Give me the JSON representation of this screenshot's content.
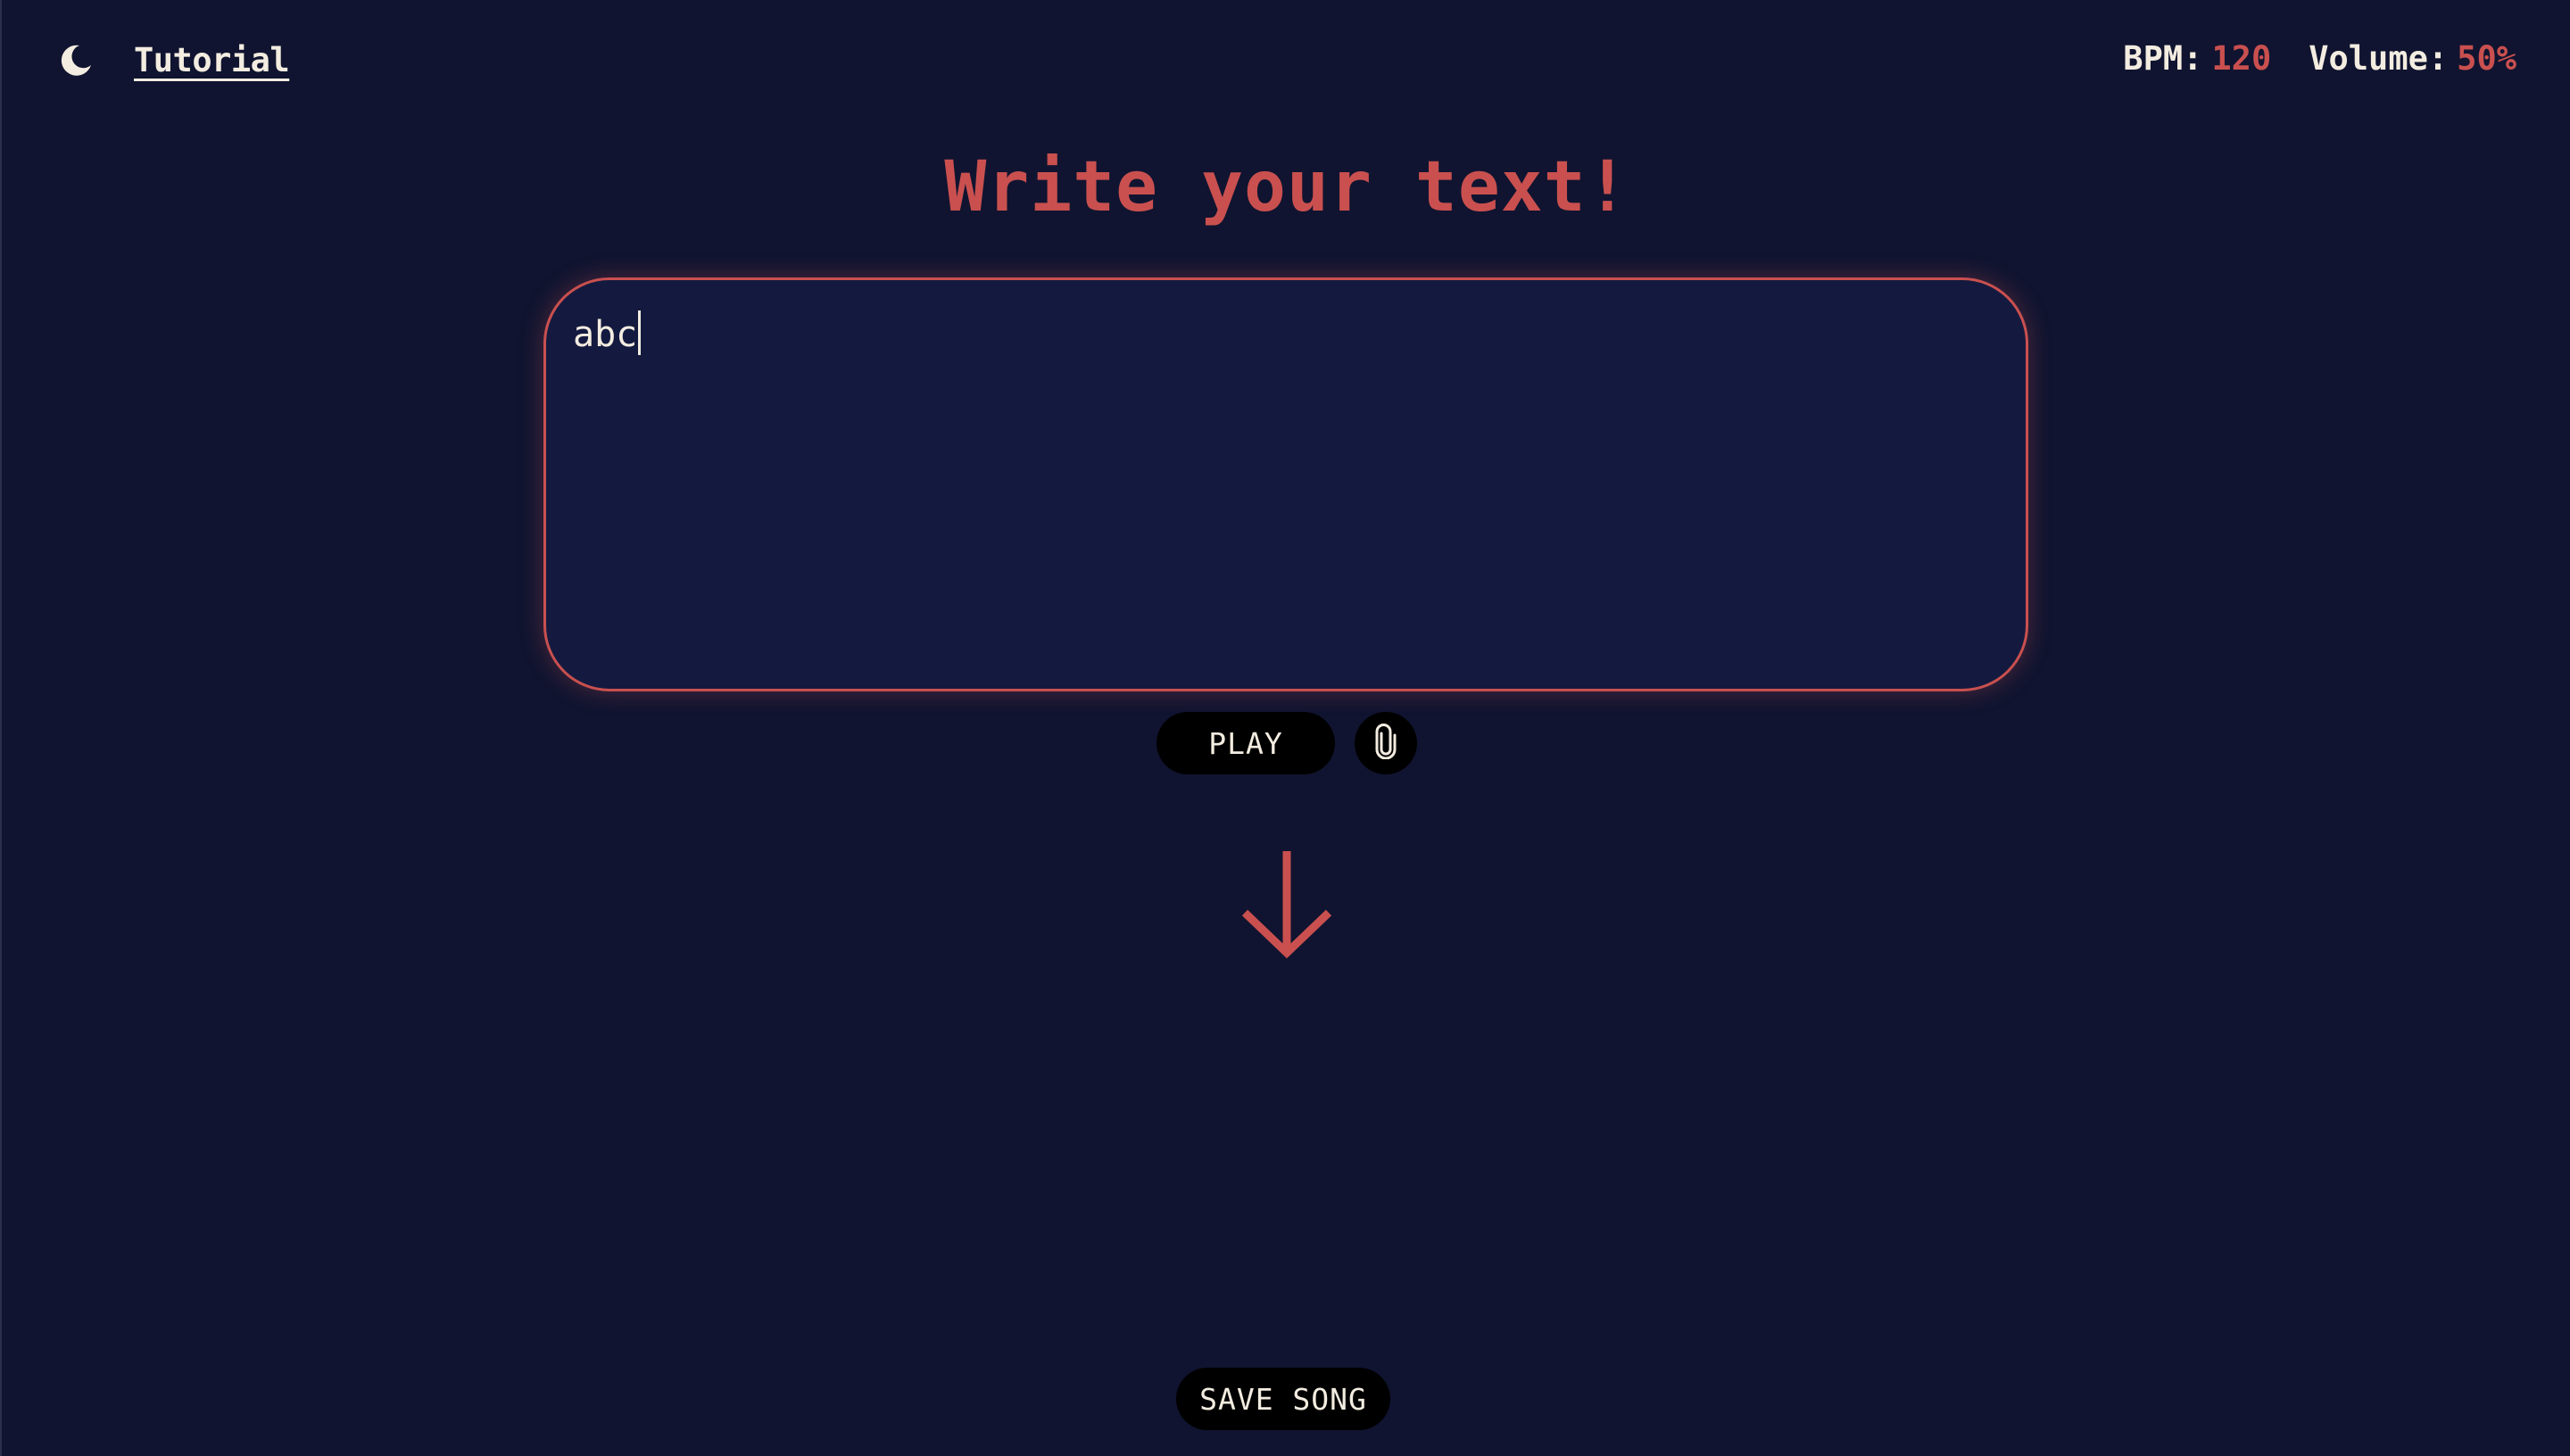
{
  "header": {
    "theme_icon": "moon-icon",
    "tutorial_label": "Tutorial",
    "bpm_label": "BPM:",
    "bpm_value": "120",
    "volume_label": "Volume:",
    "volume_value": "50%"
  },
  "main": {
    "title": "Write your text!",
    "editor_value": "abc",
    "play_label": "PLAY",
    "attach_icon": "paperclip-icon",
    "arrow_icon": "arrow-down-icon",
    "save_label": "SAVE SONG"
  },
  "colors": {
    "background": "#101430",
    "editor_background": "#141a3f",
    "accent": "#c9504f",
    "text": "#f3ece0",
    "button": "#000000"
  }
}
